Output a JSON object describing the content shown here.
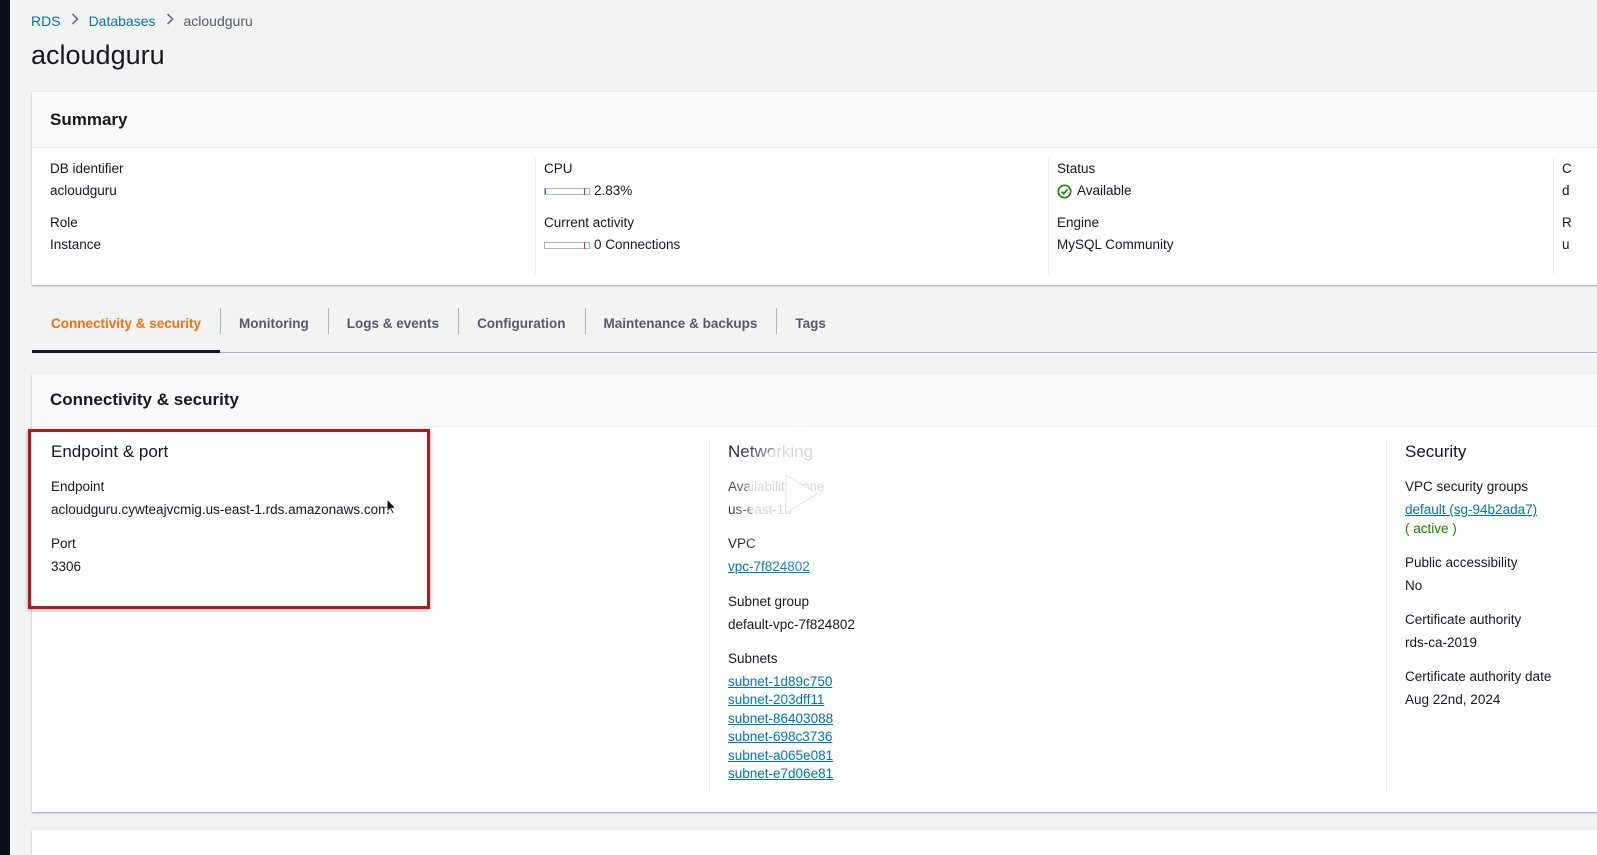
{
  "breadcrumb": {
    "root": "RDS",
    "parent": "Databases",
    "current": "acloudguru"
  },
  "page_title": "acloudguru",
  "summary": {
    "title": "Summary",
    "db_identifier_label": "DB identifier",
    "db_identifier_value": "acloudguru",
    "role_label": "Role",
    "role_value": "Instance",
    "cpu_label": "CPU",
    "cpu_value": "2.83%",
    "cpu_fraction": 0.0283,
    "activity_label": "Current activity",
    "activity_value": "0 Connections",
    "status_label": "Status",
    "status_value": "Available",
    "engine_label": "Engine",
    "engine_value": "MySQL Community",
    "col4_label_1": "C",
    "col4_value_1": "d",
    "col4_label_2": "R",
    "col4_value_2": "u"
  },
  "tabs": [
    {
      "label": "Connectivity & security",
      "active": true
    },
    {
      "label": "Monitoring"
    },
    {
      "label": "Logs & events"
    },
    {
      "label": "Configuration"
    },
    {
      "label": "Maintenance & backups"
    },
    {
      "label": "Tags"
    }
  ],
  "connectivity": {
    "title": "Connectivity & security",
    "endpoint_section": {
      "heading": "Endpoint & port",
      "endpoint_label": "Endpoint",
      "endpoint_value": "acloudguru.cywteajvcmig.us-east-1.rds.amazonaws.com",
      "port_label": "Port",
      "port_value": "3306"
    },
    "networking_section": {
      "heading": "Networking",
      "az_label": "Availability zone",
      "az_value": "us-east-1b",
      "vpc_label": "VPC",
      "vpc_value": "vpc-7f824802",
      "subnet_group_label": "Subnet group",
      "subnet_group_value": "default-vpc-7f824802",
      "subnets_label": "Subnets",
      "subnets": [
        "subnet-1d89c750",
        "subnet-203dff11",
        "subnet-86403088",
        "subnet-698c3736",
        "subnet-a065e081",
        "subnet-e7d06e81"
      ]
    },
    "security_section": {
      "heading": "Security",
      "sg_label": "VPC security groups",
      "sg_value": "default (sg-94b2ada7)",
      "sg_status": "( active )",
      "public_label": "Public accessibility",
      "public_value": "No",
      "ca_label": "Certificate authority",
      "ca_value": "rds-ca-2019",
      "ca_date_label": "Certificate authority date",
      "ca_date_value": "Aug 22nd, 2024"
    }
  },
  "colors": {
    "link": "#0073bb",
    "active_tab": "#ec7211",
    "success": "#1d8102",
    "highlight": "#b0191e"
  },
  "icons": [
    "chevron-right-icon",
    "status-available-icon",
    "play-icon",
    "mouse-cursor-icon"
  ]
}
